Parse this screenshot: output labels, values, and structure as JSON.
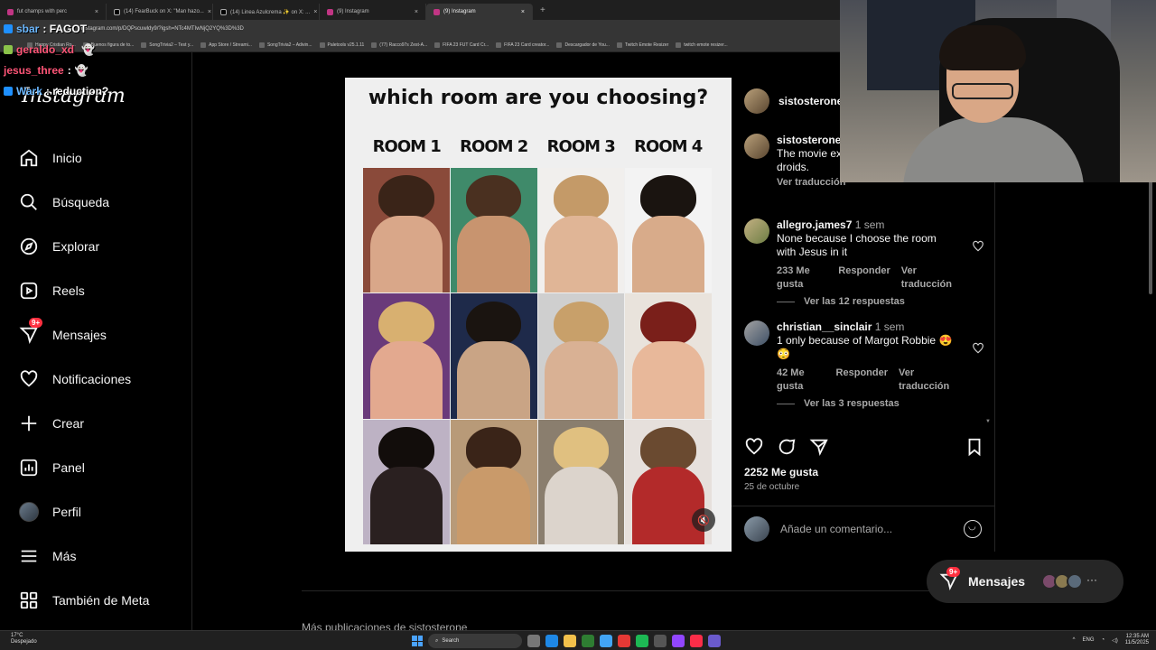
{
  "browser": {
    "tabs": [
      {
        "title": "fut champs with perc",
        "active": false
      },
      {
        "title": "(14) FearBuck on X: \"Man hazo...",
        "active": false
      },
      {
        "title": "(14) Linea Azulcrema ✨ on X: ...",
        "active": false
      },
      {
        "title": "(9) Instagram",
        "active": false
      },
      {
        "title": "(9) Instagram",
        "active": true
      }
    ],
    "url": "instagram.com/p/DQPscuwldy9/?igsh=NTc4MTIwNjQ2YQ%3D%3D",
    "bookmarks": [
      "Happy Cristian Ro...",
      "Buenos figura de to...",
      "SongTrivia2 – Test y...",
      "App Store / Streami...",
      "SongTrivia2 – Adivin...",
      "Paletools v25.1.11",
      "(77) Racco97s Zest-A...",
      "FIFA 23 FUT Card Cr...",
      "FIFA 23 Card creator...",
      "Descargador de You...",
      "Twitch Emote Resizer",
      "twitch emote resizer..."
    ]
  },
  "chat": [
    {
      "user": "sbar",
      "message": ": FAGOT"
    },
    {
      "user": "geraldo_xd",
      "message": ""
    },
    {
      "user": "jesus_three",
      "message": ":"
    },
    {
      "user": "Wark",
      "message": ": reduction?"
    }
  ],
  "sidebar": {
    "logo": "Instagram",
    "items": [
      {
        "label": "Inicio",
        "icon": "home-icon"
      },
      {
        "label": "Búsqueda",
        "icon": "search-icon"
      },
      {
        "label": "Explorar",
        "icon": "compass-icon"
      },
      {
        "label": "Reels",
        "icon": "reels-icon"
      },
      {
        "label": "Mensajes",
        "icon": "messenger-icon",
        "badge": "9+"
      },
      {
        "label": "Notificaciones",
        "icon": "heart-icon"
      },
      {
        "label": "Crear",
        "icon": "plus-icon"
      },
      {
        "label": "Panel",
        "icon": "dashboard-icon"
      },
      {
        "label": "Perfil",
        "icon": "avatar"
      },
      {
        "label": "Más",
        "icon": "menu-icon"
      },
      {
        "label": "También de Meta",
        "icon": "meta-icon"
      }
    ]
  },
  "post": {
    "title": "which room are you choosing?",
    "rooms": [
      "ROOM 1",
      "ROOM 2",
      "ROOM 3",
      "ROOM 4"
    ],
    "author": "sistosterone",
    "caption_user": "sistosterone",
    "caption": "The movie ex... Star Wars be... droids.",
    "caption_translate": "Ver traducción",
    "comments": [
      {
        "user": "allegro.james7",
        "time": "1 sem",
        "text": "None because I choose the room with Jesus in it",
        "likes": "233 Me gusta",
        "reply": "Responder",
        "translate": "Ver traducción",
        "replies": "Ver las 12 respuestas"
      },
      {
        "user": "christian__sinclair",
        "time": "1 sem",
        "text": "1 only because of Margot Robbie 😍😳",
        "likes": "42 Me gusta",
        "reply": "Responder",
        "translate": "Ver traducción",
        "replies": "Ver las 3 respuestas"
      }
    ],
    "like_count": "2252 Me gusta",
    "date": "25 de octubre",
    "comment_placeholder": "Añade un comentario..."
  },
  "messages_pill": {
    "label": "Mensajes",
    "badge": "9+"
  },
  "footer_text": "Más publicaciones de sistosterone",
  "taskbar": {
    "weather_temp": "17°C",
    "weather_desc": "Despejado",
    "search": "Search",
    "lang": "ENG",
    "time": "12:35 AM",
    "date": "11/5/2025"
  }
}
